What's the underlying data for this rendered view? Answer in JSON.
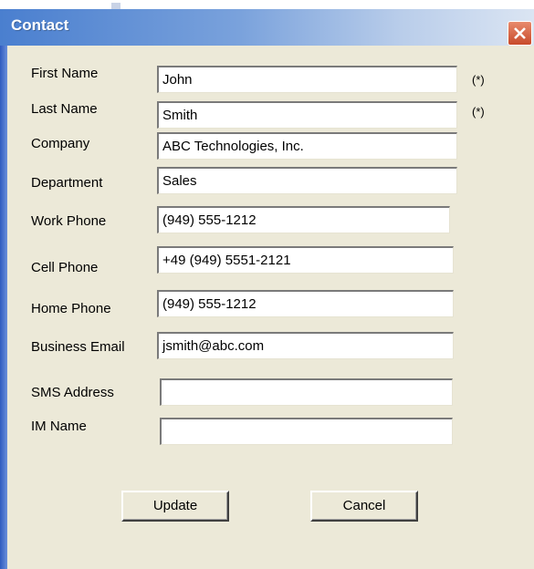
{
  "window": {
    "title": "Contact"
  },
  "fields": [
    {
      "label": "First Name",
      "value": "John",
      "required": "(*)"
    },
    {
      "label": "Last Name",
      "value": "Smith",
      "required": "(*)"
    },
    {
      "label": "Company",
      "value": "ABC Technologies, Inc."
    },
    {
      "label": "Department",
      "value": "Sales"
    },
    {
      "label": "Work Phone",
      "value": "(949) 555-1212"
    },
    {
      "label": "Cell Phone",
      "value": "+49 (949) 5551-2121"
    },
    {
      "label": "Home Phone",
      "value": "(949) 555-1212"
    },
    {
      "label": "Business Email",
      "value": "jsmith@abc.com"
    },
    {
      "label": "SMS Address",
      "value": ""
    },
    {
      "label": "IM Name",
      "value": ""
    }
  ],
  "buttons": {
    "update": "Update",
    "cancel": "Cancel"
  },
  "icons": {
    "close": "close-icon"
  },
  "colors": {
    "titlebar": "#4a7fcf",
    "body": "#ece9d8",
    "close": "#c84a2a"
  }
}
